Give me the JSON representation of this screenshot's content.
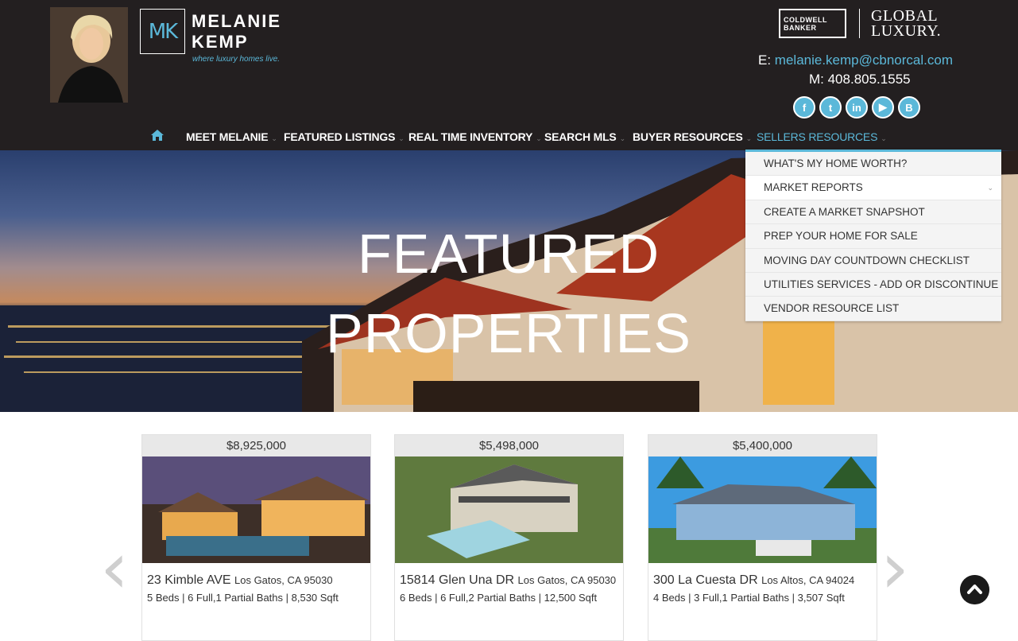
{
  "header": {
    "agent_name_line1": "MELANIE",
    "agent_name_line2": "KEMP",
    "logo_monogram": "MK",
    "tagline": "where luxury homes live.",
    "brand_cb_line1": "COLDWELL",
    "brand_cb_line2": "BANKER",
    "brand_gl_line1": "GLOBAL",
    "brand_gl_line2": "LUXURY.",
    "email_label": "E:",
    "email": "melanie.kemp@cbnorcal.com",
    "mobile": "M: 408.805.1555",
    "social": [
      {
        "icon": "facebook-icon",
        "glyph": "f"
      },
      {
        "icon": "twitter-icon",
        "glyph": "t"
      },
      {
        "icon": "linkedin-icon",
        "glyph": "in"
      },
      {
        "icon": "youtube-icon",
        "glyph": "▶"
      },
      {
        "icon": "blogger-icon",
        "glyph": "B"
      }
    ]
  },
  "nav": {
    "items": [
      {
        "label": "MEET MELANIE"
      },
      {
        "label": "FEATURED LISTINGS"
      },
      {
        "label": "REAL TIME INVENTORY"
      },
      {
        "label": "SEARCH MLS"
      },
      {
        "label": "BUYER RESOURCES"
      },
      {
        "label": "SELLERS RESOURCES"
      }
    ],
    "caret": "⌄"
  },
  "dropdown": {
    "items": [
      {
        "label": "WHAT'S MY HOME WORTH?"
      },
      {
        "label": "MARKET REPORTS"
      },
      {
        "label": "CREATE A MARKET SNAPSHOT"
      },
      {
        "label": "PREP YOUR HOME FOR SALE"
      },
      {
        "label": "MOVING DAY COUNTDOWN CHECKLIST"
      },
      {
        "label": "UTILITIES SERVICES - ADD OR DISCONTINUE"
      },
      {
        "label": "VENDOR RESOURCE LIST"
      }
    ]
  },
  "hero": {
    "line1": "FEATURED",
    "line2": "PROPERTIES"
  },
  "listings": [
    {
      "price": "$8,925,000",
      "street": "23 Kimble AVE",
      "city": "Los Gatos, CA 95030",
      "specs": "5 Beds |    6 Full,1 Partial Baths |    8,530 Sqft"
    },
    {
      "price": "$5,498,000",
      "street": "15814 Glen Una DR",
      "city": "Los Gatos, CA 95030",
      "specs": "6 Beds |    6 Full,2 Partial Baths |    12,500 Sqft"
    },
    {
      "price": "$5,400,000",
      "street": "300 La Cuesta DR",
      "city": "Los Altos, CA 94024",
      "specs": "4 Beds |    3 Full,1 Partial Baths |    3,507 Sqft"
    }
  ],
  "colors": {
    "accent": "#5bb8d9",
    "header_bg": "#231f20"
  }
}
